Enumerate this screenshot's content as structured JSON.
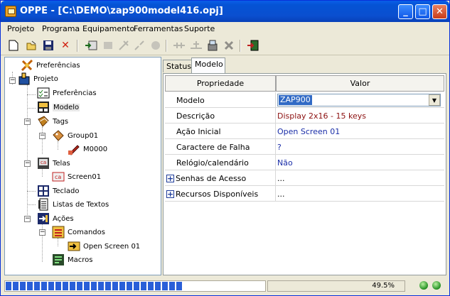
{
  "window": {
    "title": "OPPE - [C:\\DEMO\\zap900model416.opj]"
  },
  "menu": [
    "Projeto",
    "Programa",
    "Equipamento",
    "Ferramentas",
    "Suporte"
  ],
  "toolbar": {
    "icons": [
      "new-icon",
      "open-icon",
      "save-icon",
      "delete-icon",
      "send-icon",
      "receive-icon",
      "connect-icon",
      "disconnect-icon",
      "stop-icon",
      "plug-icon",
      "plug2-icon",
      "compile-icon",
      "tools-icon",
      "exit-icon"
    ]
  },
  "tree": {
    "preferences_root": "Preferências",
    "project": "Projeto",
    "preferences": "Preferências",
    "model": "Modelo",
    "tags": "Tags",
    "group01": "Group01",
    "m0000": "M0000",
    "screens": "Telas",
    "screen01": "Screen01",
    "keyboard": "Teclado",
    "text_lists": "Listas de Textos",
    "actions": "Ações",
    "commands": "Comandos",
    "open_screen01": "Open Screen 01",
    "macros": "Macros"
  },
  "tabs": [
    "Status",
    "Modelo"
  ],
  "grid": {
    "col_property": "Propriedade",
    "col_value": "Valor",
    "rows": [
      {
        "prop": "Modelo",
        "value": "ZAP900"
      },
      {
        "prop": "Descrição",
        "value": "Display 2x16 - 15 keys"
      },
      {
        "prop": "Ação Inicial",
        "value": "Open Screen 01"
      },
      {
        "prop": "Caractere de Falha",
        "value": "?"
      },
      {
        "prop": "Relógio/calendário",
        "value": "Não"
      },
      {
        "prop": "Senhas de Acesso",
        "value": "..."
      },
      {
        "prop": "Recursos Disponíveis",
        "value": "..."
      }
    ]
  },
  "status": {
    "progress": 0.68,
    "zoom": "49.5%"
  },
  "colors": {
    "link_blue": "#1a2ea8",
    "desc_red": "#8c1010",
    "selection": "#316ac5"
  }
}
